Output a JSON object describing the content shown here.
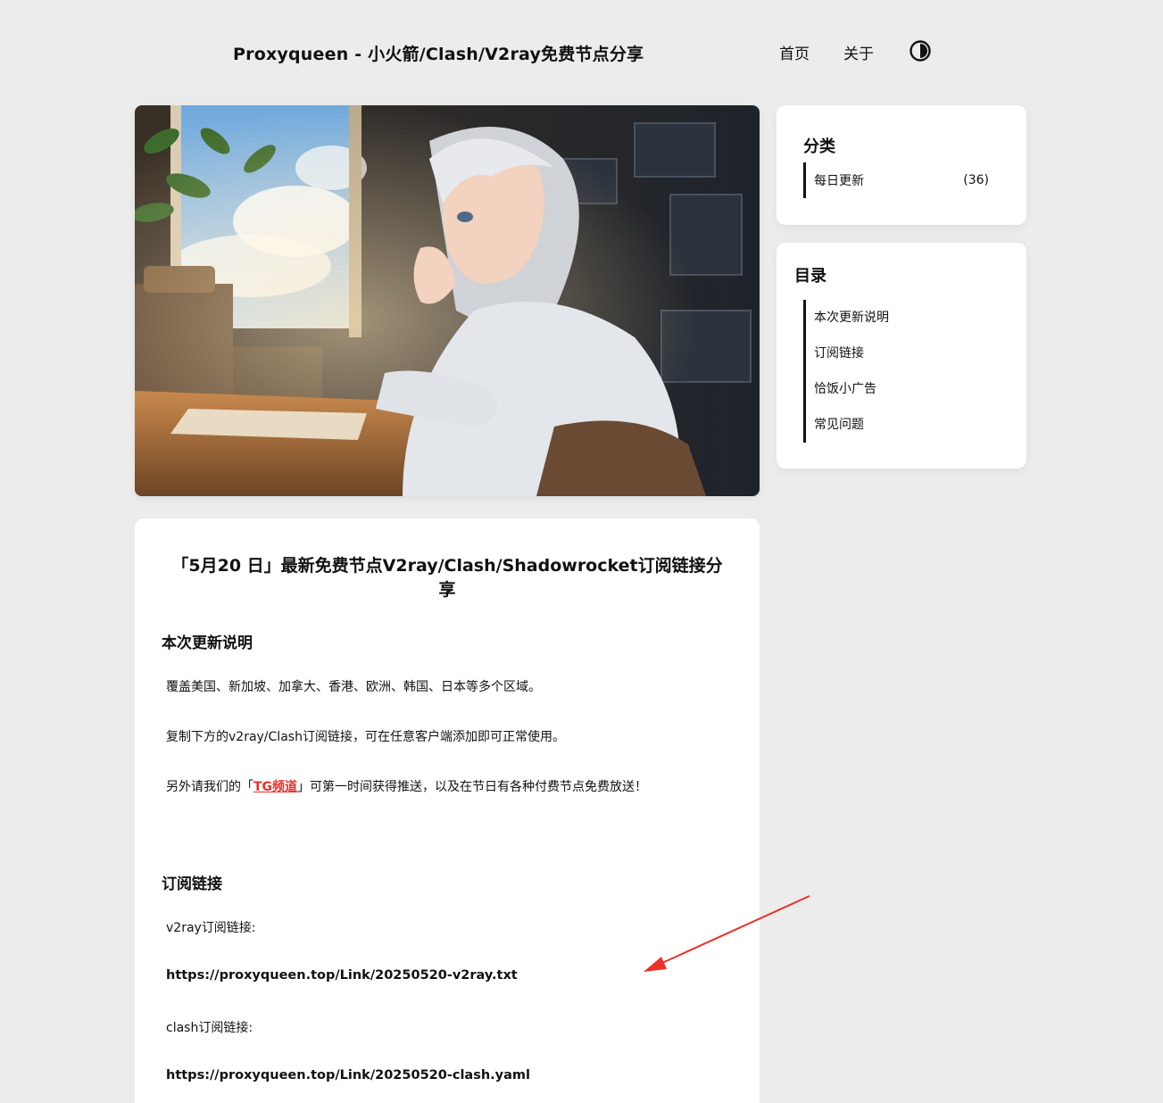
{
  "header": {
    "site_title": "Proxyqueen - 小火箭/Clash/V2ray免费节点分享",
    "nav": [
      {
        "label": "首页"
      },
      {
        "label": "关于"
      }
    ],
    "theme_toggle_icon": "contrast-icon"
  },
  "hero": {
    "icon": "hero-illustration-icon"
  },
  "sidebar": {
    "categories": {
      "title": "分类",
      "items": [
        {
          "label": "每日更新",
          "count": "(36)"
        }
      ]
    },
    "toc": {
      "title": "目录",
      "items": [
        {
          "label": "本次更新说明"
        },
        {
          "label": "订阅链接"
        },
        {
          "label": "恰饭小广告"
        },
        {
          "label": "常见问题"
        }
      ]
    }
  },
  "article": {
    "title": "「5月20 日」最新免费节点V2ray/Clash/Shadowrocket订阅链接分享",
    "sections": {
      "update": {
        "heading": "本次更新说明",
        "p1": "覆盖美国、新加坡、加拿大、香港、欧洲、韩国、日本等多个区域。",
        "p2": "复制下方的v2ray/Clash订阅链接，可在任意客户端添加即可正常使用。",
        "p3_before": "另外请我们的「",
        "p3_link": "TG频道",
        "p3_after": "」可第一时间获得推送，以及在节日有各种付费节点免费放送！"
      },
      "subscribe": {
        "heading": "订阅链接",
        "v2ray_label": "v2ray订阅链接:",
        "v2ray_url": "https://proxyqueen.top/Link/20250520-v2ray.txt",
        "clash_label": "clash订阅链接:",
        "clash_url": "https://proxyqueen.top/Link/20250520-clash.yaml"
      }
    }
  },
  "colors": {
    "background": "#ececec",
    "card": "#ffffff",
    "link_red": "#e4322a",
    "arrow_red": "#e8322a"
  }
}
